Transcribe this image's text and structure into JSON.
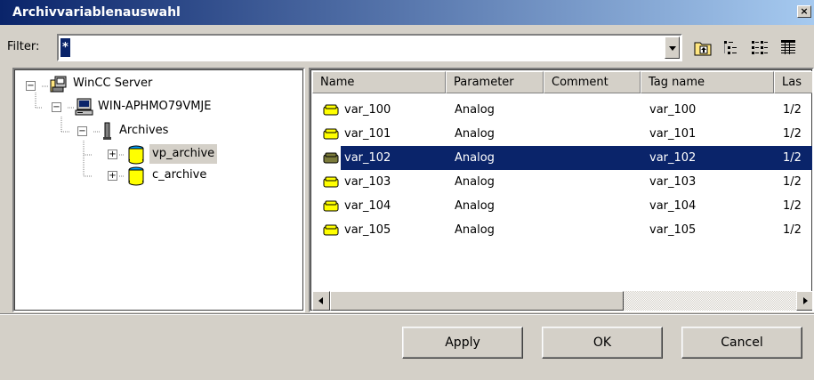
{
  "window": {
    "title": "Archivvariablenauswahl",
    "close_glyph": "×"
  },
  "filter": {
    "label": "Filter:",
    "value": "*"
  },
  "toolbar": {
    "icons": [
      "folder-up-icon",
      "list-view-icon",
      "small-icons-view-icon",
      "details-view-icon"
    ]
  },
  "tree": {
    "server": "WinCC Server",
    "computer": "WIN-APHMO79VMJE",
    "archives": "Archives",
    "children": [
      "vp_archive",
      "c_archive"
    ],
    "expand_glyph": "+",
    "collapse_glyph": "−"
  },
  "list": {
    "columns": [
      "Name",
      "Parameter",
      "Comment",
      "Tag name",
      "Las"
    ],
    "rows": [
      {
        "name": "var_100",
        "parameter": "Analog",
        "comment": "",
        "tag": "var_100",
        "last": "1/2"
      },
      {
        "name": "var_101",
        "parameter": "Analog",
        "comment": "",
        "tag": "var_101",
        "last": "1/2"
      },
      {
        "name": "var_102",
        "parameter": "Analog",
        "comment": "",
        "tag": "var_102",
        "last": "1/2"
      },
      {
        "name": "var_103",
        "parameter": "Analog",
        "comment": "",
        "tag": "var_103",
        "last": "1/2"
      },
      {
        "name": "var_104",
        "parameter": "Analog",
        "comment": "",
        "tag": "var_104",
        "last": "1/2"
      },
      {
        "name": "var_105",
        "parameter": "Analog",
        "comment": "",
        "tag": "var_105",
        "last": "1/2"
      }
    ],
    "selected_index": 2
  },
  "buttons": {
    "apply": "Apply",
    "ok": "OK",
    "cancel": "Cancel"
  },
  "colors": {
    "selection": "#0a246a",
    "title_start": "#0a246a",
    "title_end": "#a6caf0",
    "face": "#d4d0c8",
    "db_yellow": "#ffff00"
  }
}
